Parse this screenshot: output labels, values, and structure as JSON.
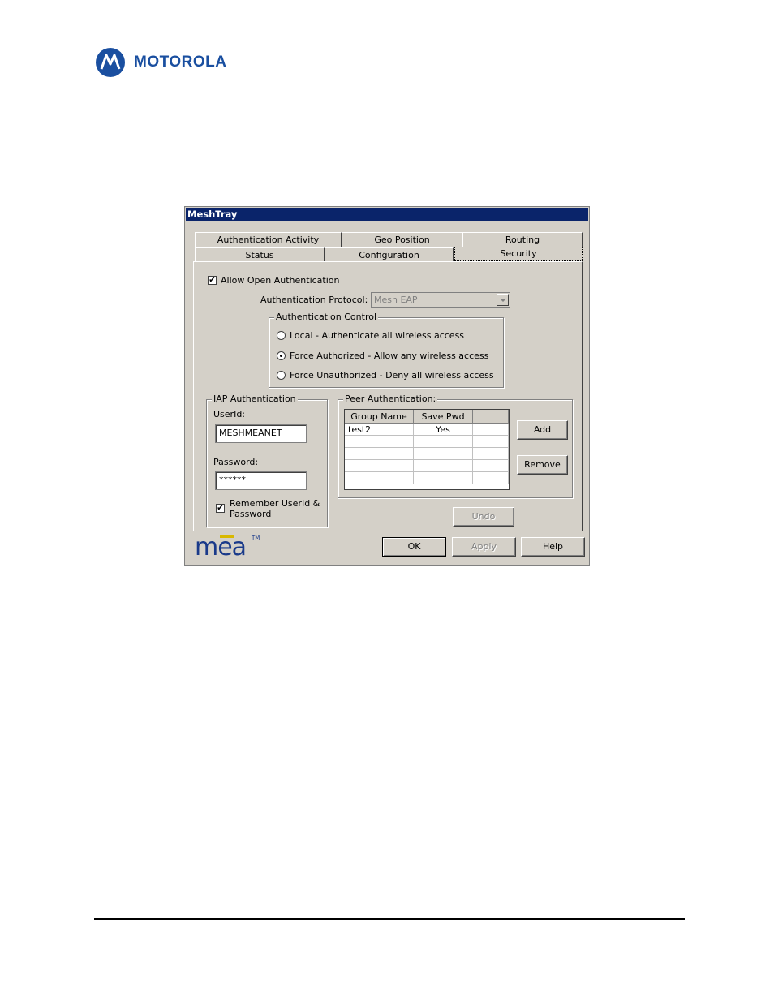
{
  "header": {
    "brand": "MOTOROLA"
  },
  "window": {
    "title": "MeshTray"
  },
  "tabs": {
    "row1": [
      "Authentication Activity",
      "Geo Position",
      "Routing"
    ],
    "row2": [
      "Status",
      "Configuration",
      "Security"
    ],
    "active": "Security"
  },
  "open_auth": {
    "label": "Allow Open Authentication",
    "checked": true,
    "protocol_label": "Authentication Protocol:",
    "protocol_value": "Mesh EAP"
  },
  "auth_control": {
    "legend": "Authentication Control",
    "options": [
      "Local - Authenticate all wireless access",
      "Force Authorized - Allow any wireless access",
      "Force Unauthorized - Deny all wireless access"
    ],
    "selected": "Force Authorized - Allow any wireless access"
  },
  "iap": {
    "legend": "IAP Authentication",
    "userid_label": "UserId:",
    "userid_value": "MESHMEANET",
    "password_label": "Password:",
    "password_value": "******",
    "remember_label_1": "Remember UserId &",
    "remember_label_2": "Password",
    "remember_checked": true
  },
  "peer": {
    "legend": "Peer Authentication:",
    "columns": [
      "Group Name",
      "Save Pwd",
      ""
    ],
    "rows": [
      [
        "test2",
        "Yes",
        ""
      ]
    ],
    "add_label": "Add",
    "remove_label": "Remove",
    "undo_label": "Undo"
  },
  "buttons": {
    "ok": "OK",
    "apply": "Apply",
    "help": "Help"
  },
  "logo_text": {
    "mea": "mea",
    "tm": "TM"
  }
}
